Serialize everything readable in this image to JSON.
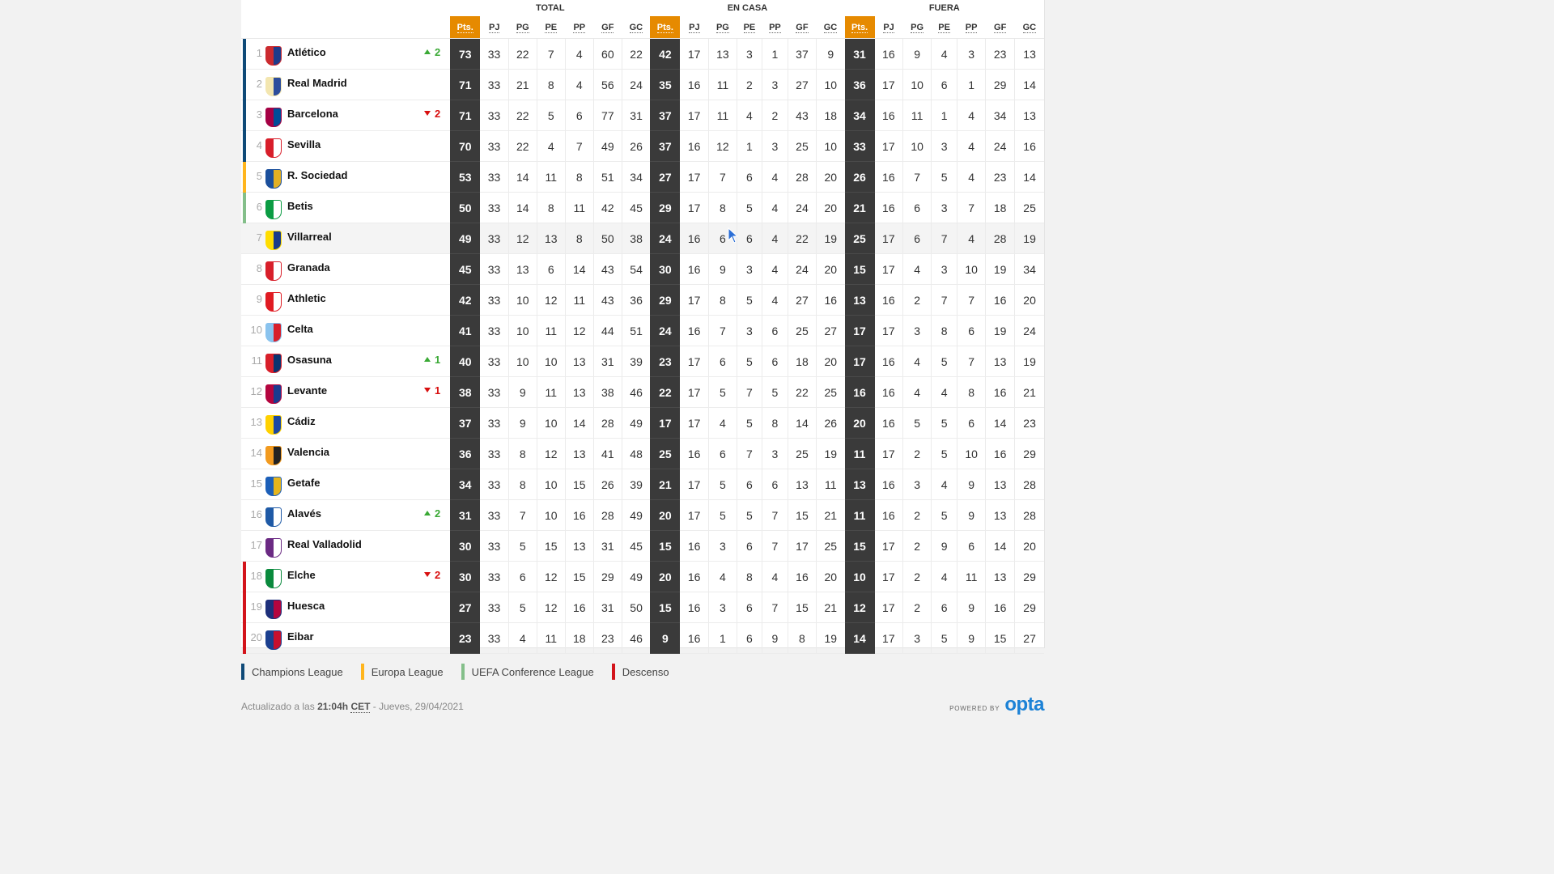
{
  "groups": {
    "total": "TOTAL",
    "home": "EN CASA",
    "away": "FUERA"
  },
  "columns": {
    "pts": "Pts.",
    "pj": "PJ",
    "pg": "PG",
    "pe": "PE",
    "pp": "PP",
    "gf": "GF",
    "gc": "GC"
  },
  "zone_colors": {
    "ucl": "#0f4a78",
    "uel": "#ffb51d",
    "uecl": "#84bf8a",
    "rel": "#d3141b"
  },
  "legend": [
    {
      "label": "Champions League",
      "zone": "ucl"
    },
    {
      "label": "Europa League",
      "zone": "uel"
    },
    {
      "label": "UEFA Conference League",
      "zone": "uecl"
    },
    {
      "label": "Descenso",
      "zone": "rel"
    }
  ],
  "highlighted_row": 7,
  "teams": [
    {
      "pos": "1",
      "name": "Atlético",
      "zone": "ucl",
      "change": {
        "dir": "up",
        "val": "2"
      },
      "crest": [
        "#cb2a2f",
        "#1f3b8a"
      ],
      "total": [
        "73",
        "33",
        "22",
        "7",
        "4",
        "60",
        "22"
      ],
      "home": [
        "42",
        "17",
        "13",
        "3",
        "1",
        "37",
        "9"
      ],
      "away": [
        "31",
        "16",
        "9",
        "4",
        "3",
        "23",
        "13"
      ]
    },
    {
      "pos": "2",
      "name": "Real Madrid",
      "zone": "ucl",
      "change": null,
      "crest": [
        "#f3e6b0",
        "#2c4d9c"
      ],
      "total": [
        "71",
        "33",
        "21",
        "8",
        "4",
        "56",
        "24"
      ],
      "home": [
        "35",
        "16",
        "11",
        "2",
        "3",
        "27",
        "10"
      ],
      "away": [
        "36",
        "17",
        "10",
        "6",
        "1",
        "29",
        "14"
      ]
    },
    {
      "pos": "3",
      "name": "Barcelona",
      "zone": "ucl",
      "change": {
        "dir": "down",
        "val": "2"
      },
      "crest": [
        "#a50044",
        "#004d98"
      ],
      "total": [
        "71",
        "33",
        "22",
        "5",
        "6",
        "77",
        "31"
      ],
      "home": [
        "37",
        "17",
        "11",
        "4",
        "2",
        "43",
        "18"
      ],
      "away": [
        "34",
        "16",
        "11",
        "1",
        "4",
        "34",
        "13"
      ]
    },
    {
      "pos": "4",
      "name": "Sevilla",
      "zone": "ucl",
      "change": null,
      "crest": [
        "#d81e2a",
        "#ffffff"
      ],
      "total": [
        "70",
        "33",
        "22",
        "4",
        "7",
        "49",
        "26"
      ],
      "home": [
        "37",
        "16",
        "12",
        "1",
        "3",
        "25",
        "10"
      ],
      "away": [
        "33",
        "17",
        "10",
        "3",
        "4",
        "24",
        "16"
      ]
    },
    {
      "pos": "5",
      "name": "R. Sociedad",
      "zone": "uel",
      "change": null,
      "crest": [
        "#1b4f9c",
        "#e3b023"
      ],
      "total": [
        "53",
        "33",
        "14",
        "11",
        "8",
        "51",
        "34"
      ],
      "home": [
        "27",
        "17",
        "7",
        "6",
        "4",
        "28",
        "20"
      ],
      "away": [
        "26",
        "16",
        "7",
        "5",
        "4",
        "23",
        "14"
      ]
    },
    {
      "pos": "6",
      "name": "Betis",
      "zone": "uecl",
      "change": null,
      "crest": [
        "#0b9c43",
        "#ffffff"
      ],
      "total": [
        "50",
        "33",
        "14",
        "8",
        "11",
        "42",
        "45"
      ],
      "home": [
        "29",
        "17",
        "8",
        "5",
        "4",
        "24",
        "20"
      ],
      "away": [
        "21",
        "16",
        "6",
        "3",
        "7",
        "18",
        "25"
      ]
    },
    {
      "pos": "7",
      "name": "Villarreal",
      "zone": null,
      "change": null,
      "crest": [
        "#ffdd00",
        "#1a3c8a"
      ],
      "total": [
        "49",
        "33",
        "12",
        "13",
        "8",
        "50",
        "38"
      ],
      "home": [
        "24",
        "16",
        "6",
        "6",
        "4",
        "22",
        "19"
      ],
      "away": [
        "25",
        "17",
        "6",
        "7",
        "4",
        "28",
        "19"
      ]
    },
    {
      "pos": "8",
      "name": "Granada",
      "zone": null,
      "change": null,
      "crest": [
        "#d81f2a",
        "#ffffff"
      ],
      "total": [
        "45",
        "33",
        "13",
        "6",
        "14",
        "43",
        "54"
      ],
      "home": [
        "30",
        "16",
        "9",
        "3",
        "4",
        "24",
        "20"
      ],
      "away": [
        "15",
        "17",
        "4",
        "3",
        "10",
        "19",
        "34"
      ]
    },
    {
      "pos": "9",
      "name": "Athletic",
      "zone": null,
      "change": null,
      "crest": [
        "#e01b22",
        "#ffffff"
      ],
      "total": [
        "42",
        "33",
        "10",
        "12",
        "11",
        "43",
        "36"
      ],
      "home": [
        "29",
        "17",
        "8",
        "5",
        "4",
        "27",
        "16"
      ],
      "away": [
        "13",
        "16",
        "2",
        "7",
        "7",
        "16",
        "20"
      ]
    },
    {
      "pos": "10",
      "name": "Celta",
      "zone": null,
      "change": null,
      "crest": [
        "#8ac3ee",
        "#d81f2a"
      ],
      "total": [
        "41",
        "33",
        "10",
        "11",
        "12",
        "44",
        "51"
      ],
      "home": [
        "24",
        "16",
        "7",
        "3",
        "6",
        "25",
        "27"
      ],
      "away": [
        "17",
        "17",
        "3",
        "8",
        "6",
        "19",
        "24"
      ]
    },
    {
      "pos": "11",
      "name": "Osasuna",
      "zone": null,
      "change": {
        "dir": "up",
        "val": "1"
      },
      "crest": [
        "#d81f2a",
        "#0a346f"
      ],
      "total": [
        "40",
        "33",
        "10",
        "10",
        "13",
        "31",
        "39"
      ],
      "home": [
        "23",
        "17",
        "6",
        "5",
        "6",
        "18",
        "20"
      ],
      "away": [
        "17",
        "16",
        "4",
        "5",
        "7",
        "13",
        "19"
      ]
    },
    {
      "pos": "12",
      "name": "Levante",
      "zone": null,
      "change": {
        "dir": "down",
        "val": "1"
      },
      "crest": [
        "#b4053f",
        "#1b3b8f"
      ],
      "total": [
        "38",
        "33",
        "9",
        "11",
        "13",
        "38",
        "46"
      ],
      "home": [
        "22",
        "17",
        "5",
        "7",
        "5",
        "22",
        "25"
      ],
      "away": [
        "16",
        "16",
        "4",
        "4",
        "8",
        "16",
        "21"
      ]
    },
    {
      "pos": "13",
      "name": "Cádiz",
      "zone": null,
      "change": null,
      "crest": [
        "#ffd100",
        "#1c49a3"
      ],
      "total": [
        "37",
        "33",
        "9",
        "10",
        "14",
        "28",
        "49"
      ],
      "home": [
        "17",
        "17",
        "4",
        "5",
        "8",
        "14",
        "26"
      ],
      "away": [
        "20",
        "16",
        "5",
        "5",
        "6",
        "14",
        "23"
      ]
    },
    {
      "pos": "14",
      "name": "Valencia",
      "zone": null,
      "change": null,
      "crest": [
        "#f29a1f",
        "#222222"
      ],
      "total": [
        "36",
        "33",
        "8",
        "12",
        "13",
        "41",
        "48"
      ],
      "home": [
        "25",
        "16",
        "6",
        "7",
        "3",
        "25",
        "19"
      ],
      "away": [
        "11",
        "17",
        "2",
        "5",
        "10",
        "16",
        "29"
      ]
    },
    {
      "pos": "15",
      "name": "Getafe",
      "zone": null,
      "change": null,
      "crest": [
        "#1c5fb8",
        "#e5b51d"
      ],
      "total": [
        "34",
        "33",
        "8",
        "10",
        "15",
        "26",
        "39"
      ],
      "home": [
        "21",
        "17",
        "5",
        "6",
        "6",
        "13",
        "11"
      ],
      "away": [
        "13",
        "16",
        "3",
        "4",
        "9",
        "13",
        "28"
      ]
    },
    {
      "pos": "16",
      "name": "Alavés",
      "zone": null,
      "change": {
        "dir": "up",
        "val": "2"
      },
      "crest": [
        "#1f5aa6",
        "#ffffff"
      ],
      "total": [
        "31",
        "33",
        "7",
        "10",
        "16",
        "28",
        "49"
      ],
      "home": [
        "20",
        "17",
        "5",
        "5",
        "7",
        "15",
        "21"
      ],
      "away": [
        "11",
        "16",
        "2",
        "5",
        "9",
        "13",
        "28"
      ]
    },
    {
      "pos": "17",
      "name": "Real Valladolid",
      "zone": null,
      "change": null,
      "crest": [
        "#6b2a83",
        "#ffffff"
      ],
      "total": [
        "30",
        "33",
        "5",
        "15",
        "13",
        "31",
        "45"
      ],
      "home": [
        "15",
        "16",
        "3",
        "6",
        "7",
        "17",
        "25"
      ],
      "away": [
        "15",
        "17",
        "2",
        "9",
        "6",
        "14",
        "20"
      ]
    },
    {
      "pos": "18",
      "name": "Elche",
      "zone": "rel",
      "change": {
        "dir": "down",
        "val": "2"
      },
      "crest": [
        "#0a8a3d",
        "#ffffff"
      ],
      "total": [
        "30",
        "33",
        "6",
        "12",
        "15",
        "29",
        "49"
      ],
      "home": [
        "20",
        "16",
        "4",
        "8",
        "4",
        "16",
        "20"
      ],
      "away": [
        "10",
        "17",
        "2",
        "4",
        "11",
        "13",
        "29"
      ]
    },
    {
      "pos": "19",
      "name": "Huesca",
      "zone": "rel",
      "change": null,
      "crest": [
        "#1d2f7a",
        "#b4053f"
      ],
      "total": [
        "27",
        "33",
        "5",
        "12",
        "16",
        "31",
        "50"
      ],
      "home": [
        "15",
        "16",
        "3",
        "6",
        "7",
        "15",
        "21"
      ],
      "away": [
        "12",
        "17",
        "2",
        "6",
        "9",
        "16",
        "29"
      ]
    },
    {
      "pos": "20",
      "name": "Eibar",
      "zone": "rel",
      "change": null,
      "crest": [
        "#1b3f8f",
        "#c8102e"
      ],
      "total": [
        "23",
        "33",
        "4",
        "11",
        "18",
        "23",
        "46"
      ],
      "home": [
        "9",
        "16",
        "1",
        "6",
        "9",
        "8",
        "19"
      ],
      "away": [
        "14",
        "17",
        "3",
        "5",
        "9",
        "15",
        "27"
      ]
    }
  ],
  "footer": {
    "updated_prefix": "Actualizado a las ",
    "time": "21:04h",
    "tz": "CET",
    "date": " - Jueves, 29/04/2021",
    "powered": "POWERED BY",
    "opta": "opta"
  }
}
